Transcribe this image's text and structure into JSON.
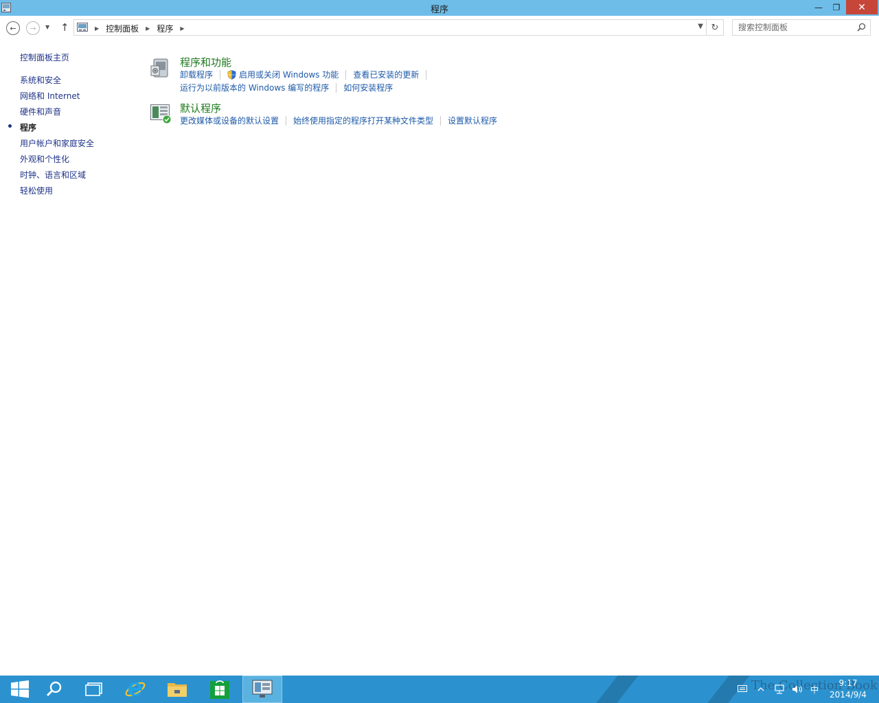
{
  "window": {
    "title": "程序",
    "controls": {
      "minimize": "—",
      "maximize": "❐",
      "close": "✕"
    }
  },
  "nav": {
    "back": "←",
    "forward": "→",
    "recent": "▼",
    "up": "↑",
    "breadcrumb_sep": "▶",
    "breadcrumbs": [
      "控制面板",
      "程序"
    ],
    "dropdown": "▼",
    "refresh": "↻"
  },
  "search": {
    "placeholder": "搜索控制面板"
  },
  "sidebar": {
    "home": "控制面板主页",
    "items": [
      {
        "label": "系统和安全"
      },
      {
        "label": "网络和 Internet"
      },
      {
        "label": "硬件和声音"
      },
      {
        "label": "程序"
      },
      {
        "label": "用户帐户和家庭安全"
      },
      {
        "label": "外观和个性化"
      },
      {
        "label": "时钟、语言和区域"
      },
      {
        "label": "轻松使用"
      }
    ]
  },
  "sections": [
    {
      "title": "程序和功能",
      "rows": [
        [
          "卸载程序",
          "启用或关闭 Windows 功能",
          "查看已安装的更新"
        ],
        [
          "运行为以前版本的 Windows 编写的程序",
          "如何安装程序"
        ]
      ]
    },
    {
      "title": "默认程序",
      "rows": [
        [
          "更改媒体或设备的默认设置",
          "始终使用指定的程序打开某种文件类型",
          "设置默认程序"
        ]
      ]
    }
  ],
  "taskbar": {
    "apps": [
      "start-icon",
      "search-icon",
      "task-view-icon",
      "internet-explorer-icon",
      "file-explorer-icon",
      "store-icon",
      "control-panel-icon"
    ],
    "ime": "中",
    "time": "9:17",
    "date": "2014/9/4",
    "watermark": "The Collection Book"
  },
  "colors": {
    "titlebar": "#6ebde8",
    "close": "#c7463a",
    "nav_link": "#1e3287",
    "task_link": "#1e5aa8",
    "heading": "#1e7a1e",
    "taskbar": "#2b92cf"
  }
}
